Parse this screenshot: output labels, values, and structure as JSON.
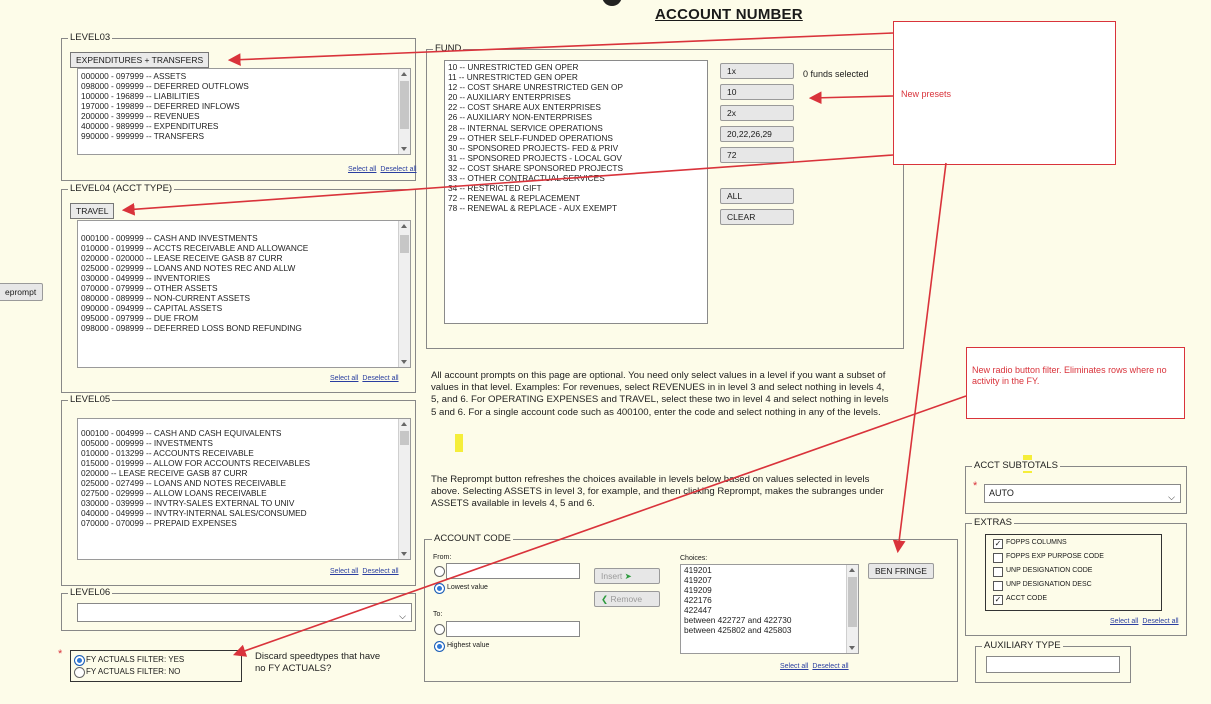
{
  "page": {
    "title": "ACCOUNT NUMBER",
    "side_tab": "eprompt"
  },
  "level03": {
    "legend": "LEVEL03",
    "chip": "EXPENDITURES + TRANSFERS",
    "items": [
      "000000 - 097999 -- ASSETS",
      "098000 - 099999 -- DEFERRED OUTFLOWS",
      "100000 - 196899 -- LIABILITIES",
      "197000 - 199899 -- DEFERRED INFLOWS",
      "200000 - 399999 -- REVENUES",
      "400000 - 989999 -- EXPENDITURES",
      "990000 - 999999 -- TRANSFERS"
    ],
    "select_all": "Select all",
    "deselect_all": "Deselect all"
  },
  "level04": {
    "legend": "LEVEL04 (ACCT TYPE)",
    "chip": "TRAVEL",
    "items": [
      "000100 - 009999 -- CASH AND INVESTMENTS",
      "010000 - 019999 -- ACCTS RECEIVABLE AND ALLOWANCE",
      "020000 - 020000 -- LEASE RECEIVE GASB 87 CURR",
      "025000 - 029999 -- LOANS AND NOTES REC AND ALLW",
      "030000 - 049999 -- INVENTORIES",
      "070000 - 079999 -- OTHER ASSETS",
      "080000 - 089999 -- NON-CURRENT ASSETS",
      "090000 - 094999 -- CAPITAL ASSETS",
      "095000 - 097999 -- DUE FROM",
      "098000 - 098999 -- DEFERRED LOSS BOND REFUNDING"
    ],
    "select_all": "Select all",
    "deselect_all": "Deselect all"
  },
  "level05": {
    "legend": "LEVEL05",
    "items": [
      "000100 - 004999 -- CASH AND CASH EQUIVALENTS",
      "005000 - 009999 -- INVESTMENTS",
      "010000 - 013299 -- ACCOUNTS RECEIVABLE",
      "015000 - 019999 -- ALLOW FOR ACCOUNTS RECEIVABLES",
      "020000 -- LEASE RECEIVE GASB 87 CURR",
      "025000 - 027499 -- LOANS AND NOTES RECEIVABLE",
      "027500 - 029999 -- ALLOW LOANS RECEIVABLE",
      "030000 - 039999 -- INVTRY-SALES EXTERNAL TO UNIV",
      "040000 - 049999 -- INVTRY-INTERNAL SALES/CONSUMED",
      "070000 - 070099 -- PREPAID EXPENSES"
    ],
    "select_all": "Select all",
    "deselect_all": "Deselect all"
  },
  "level06": {
    "legend": "LEVEL06",
    "value": ""
  },
  "fund": {
    "legend": "FUND",
    "items": [
      "10 -- UNRESTRICTED GEN OPER",
      "11 -- UNRESTRICTED GEN OPER",
      "12 -- COST SHARE UNRESTRICTED GEN OP",
      "20 -- AUXILIARY ENTERPRISES",
      "22 -- COST SHARE AUX ENTERPRISES",
      "26 -- AUXILIARY NON-ENTERPRISES",
      "28 -- INTERNAL SERVICE OPERATIONS",
      "29 -- OTHER SELF-FUNDED OPERATIONS",
      "30 -- SPONSORED PROJECTS- FED & PRIV",
      "31 -- SPONSORED PROJECTS - LOCAL GOV",
      "32 -- COST SHARE SPONSORED PROJECTS",
      "33 -- OTHER CONTRACTUAL SERVICES",
      "34 -- RESTRICTED GIFT",
      "72 -- RENEWAL & REPLACEMENT",
      "78 -- RENEWAL & REPLACE - AUX EXEMPT"
    ],
    "presets": [
      "1x",
      "10",
      "2x",
      "20,22,26,29",
      "72"
    ],
    "all": "ALL",
    "clear": "CLEAR",
    "status": "0 funds selected"
  },
  "callouts": {
    "presets": "New presets",
    "radio": "New radio button filter.  Eliminates rows where no activity in the FY."
  },
  "info": {
    "para1": "All account prompts on this page are optional.  You need only select values in a level if you want a subset of values in that level.  Examples:  For revenues, select REVENUES in in level 3 and select nothing in levels 4, 5, and 6.  For OPERATING EXPENSES and TRAVEL, select these two in level 4 and select nothing in levels 5 and 6.  For a single account code such as 400100, enter the code and select nothing in any of the levels.",
    "para2": "The Reprompt button refreshes the choices available in levels below based on values selected in levels above.  Selecting ASSETS in level 3, for example, and then clicking Reprompt, makes the subranges under ASSETS available in levels 4, 5 and 6."
  },
  "account_code": {
    "legend": "ACCOUNT CODE",
    "from_label": "From:",
    "from_value": "",
    "lowest_label": "Lowest value",
    "to_label": "To:",
    "to_value": "",
    "highest_label": "Highest value",
    "insert": "Insert",
    "remove": "Remove",
    "choices_label": "Choices:",
    "choices": [
      "419201",
      "419207",
      "419209",
      "422176",
      "422447",
      "between 422727 and 422730",
      "between 425802 and 425803"
    ],
    "select_all": "Select all",
    "deselect_all": "Deselect all",
    "ben_fringe": "BEN FRINGE"
  },
  "fy_filter": {
    "yes": "FY ACTUALS FILTER:  YES",
    "no": "FY ACTUALS FILTER:  NO",
    "note": "Discard speedtypes that have no FY ACTUALS?"
  },
  "acct_subtotals": {
    "legend": "ACCT SUBTOTALS",
    "value": "AUTO"
  },
  "extras": {
    "legend": "EXTRAS",
    "items": [
      {
        "label": "FOPPS COLUMNS",
        "checked": true
      },
      {
        "label": "FOPPS EXP PURPOSE CODE",
        "checked": false
      },
      {
        "label": "UNP DESIGNATION CODE",
        "checked": false
      },
      {
        "label": "UNP DESIGNATION DESC",
        "checked": false
      },
      {
        "label": "ACCT CODE",
        "checked": true
      }
    ],
    "select_all": "Select all",
    "deselect_all": "Deselect all"
  },
  "auxiliary_type": {
    "legend": "AUXILIARY TYPE",
    "value": ""
  },
  "colors": {
    "annotation": "#d9333b",
    "highlight": "#f5ee3a",
    "background": "#fdfce9"
  }
}
